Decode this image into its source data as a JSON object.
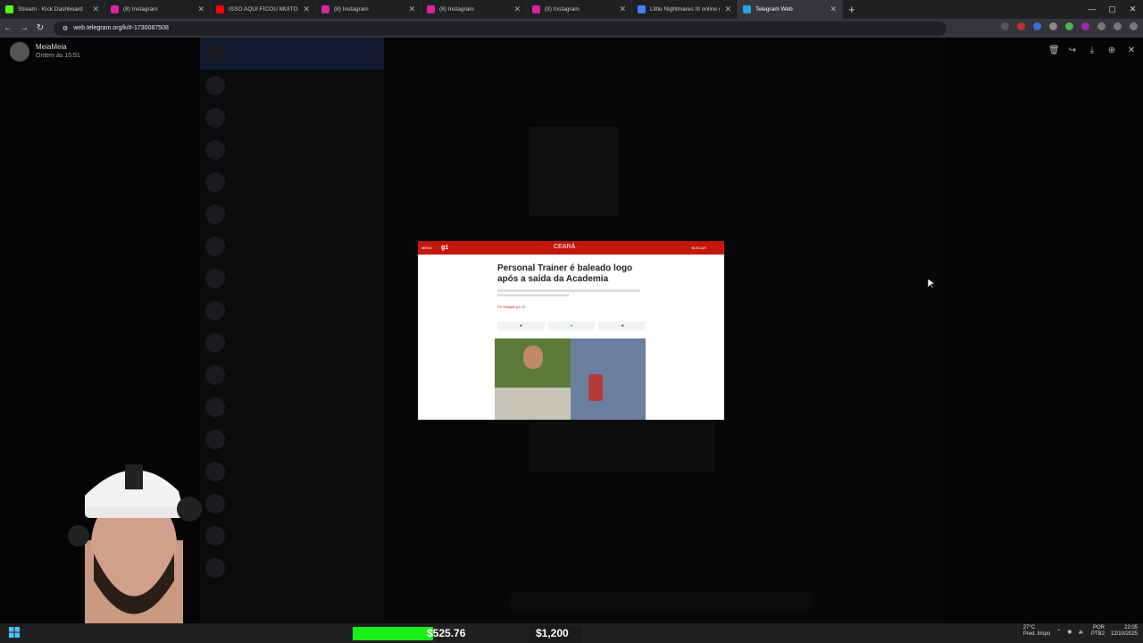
{
  "browser": {
    "tabs": [
      {
        "title": "Stream - Kick Dashboard",
        "color": "#53fc18",
        "active": false
      },
      {
        "title": "(8) Instagram",
        "color": "#d6249f",
        "active": false
      },
      {
        "title": "ISSO AQUI FICOU MUITO BOM",
        "color": "#ff0000",
        "active": false
      },
      {
        "title": "(8) Instagram",
        "color": "#d6249f",
        "active": false
      },
      {
        "title": "(8) Instagram",
        "color": "#d6249f",
        "active": false
      },
      {
        "title": "(8) Instagram",
        "color": "#d6249f",
        "active": false
      },
      {
        "title": "Little Nightmares III online grát",
        "color": "#3b82f6",
        "active": false
      },
      {
        "title": "Telegram Web",
        "color": "#2aa3e0",
        "active": true
      }
    ],
    "url": "web.telegram.org/k/#-1730087508"
  },
  "viewer": {
    "sender_name": "MeiaMeia",
    "sender_date": "Ontem às 15:51",
    "actions": [
      "delete-icon",
      "forward-icon",
      "download-icon",
      "zoom-icon",
      "close-icon"
    ]
  },
  "article": {
    "region": "CEARÁ",
    "logo": "g1",
    "menu_label": "MENU",
    "search_label": "BUSCAR",
    "headline": "Personal Trainer é baleado logo após a saída da Academia",
    "byline": "Por Redação g1 CE"
  },
  "taskbar": {
    "value_green": "$525.76",
    "value_goal": "$1,200",
    "weather_temp": "27°C",
    "weather_desc": "Pred. limpo",
    "lang": "POR",
    "lang_sub": "PTB2",
    "time": "22:05",
    "date": "12/10/2025"
  },
  "colors": {
    "g1_red": "#c4170c",
    "telegram_accent": "#2aa3e0"
  }
}
